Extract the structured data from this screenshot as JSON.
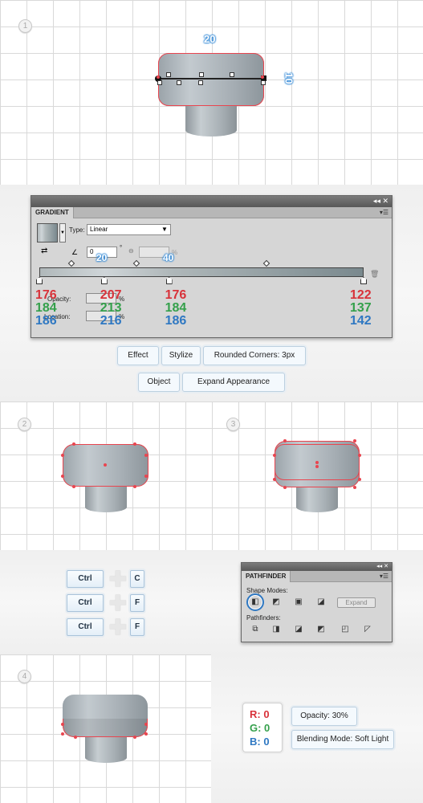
{
  "steps": [
    "1",
    "2",
    "3",
    "4"
  ],
  "dimensions": {
    "width": "20",
    "height": "10"
  },
  "gradient_panel": {
    "title": "GRADIENT",
    "type_label": "Type:",
    "type_value": "Linear",
    "angle_value": "0",
    "angle_unit": "°",
    "aspect_unit": "%",
    "overlay_20": "20",
    "overlay_40": "40",
    "opacity_label": "Opacity:",
    "location_label": "Location:",
    "percent": "%",
    "stops": [
      {
        "r": "176",
        "g": "184",
        "b": "186",
        "position": 0
      },
      {
        "r": "207",
        "g": "213",
        "b": "216",
        "position": 20
      },
      {
        "r": "176",
        "g": "184",
        "b": "186",
        "position": 40
      },
      {
        "r": "122",
        "g": "137",
        "b": "142",
        "position": 100
      }
    ],
    "colors": {
      "r": "#d8323a",
      "g": "#34a04b",
      "b": "#2f78c2"
    }
  },
  "effect_buttons": {
    "effect": "Effect",
    "stylize": "Stylize",
    "rounded": "Rounded Corners: 3px",
    "object": "Object",
    "expand": "Expand Appearance"
  },
  "shortcuts": [
    {
      "mod": "Ctrl",
      "key": "C"
    },
    {
      "mod": "Ctrl",
      "key": "F"
    },
    {
      "mod": "Ctrl",
      "key": "F"
    }
  ],
  "pathfinder": {
    "title": "PATHFINDER",
    "shape_modes": "Shape Modes:",
    "pathfinders": "Pathfinders:",
    "expand": "Expand"
  },
  "fill_color": {
    "r": "R: 0",
    "g": "G: 0",
    "b": "B: 0"
  },
  "appearance": {
    "opacity": "Opacity: 30%",
    "blending": "Blending Mode: Soft Light"
  }
}
